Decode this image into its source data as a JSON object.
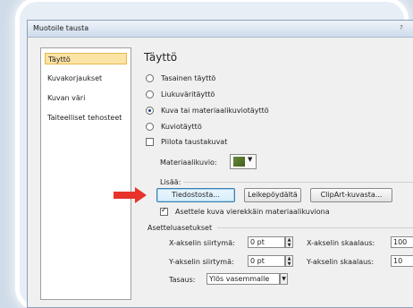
{
  "dialog": {
    "title": "Muotoile tausta",
    "help": "?"
  },
  "sidebar": {
    "items": [
      {
        "label": "Täyttö"
      },
      {
        "label": "Kuvakorjaukset"
      },
      {
        "label": "Kuvan väri"
      },
      {
        "label": "Taiteelliset tehosteet"
      }
    ]
  },
  "fill": {
    "heading": "Täyttö",
    "options": [
      {
        "label": "Tasainen täyttö",
        "checked": false
      },
      {
        "label": "Liukuväritäyttö",
        "checked": false
      },
      {
        "label": "Kuva tai materiaalikuviotäyttö",
        "checked": true
      },
      {
        "label": "Kuviotäyttö",
        "checked": false
      }
    ],
    "hide_background": "Piilota taustakuvat",
    "texture_label": "Materiaalikuvio:",
    "insert_from_label": "Lisää:",
    "buttons": {
      "file": "Tiedostosta...",
      "clipboard": "Leikepöydältä",
      "clipart": "ClipArt-kuvasta..."
    },
    "tile_label": "Asettele kuva vierekkäin materiaalikuviona",
    "tiling_heading": "Asetteluasetukset",
    "offset_x_label": "X-akselin siirtymä:",
    "offset_x_value": "0 pt",
    "offset_y_label": "Y-akselin siirtymä:",
    "offset_y_value": "0 pt",
    "scale_x_label": "X-akselin skaalaus:",
    "scale_x_value": "100",
    "scale_y_label": "Y-akselin skaalaus:",
    "scale_y_value": "10",
    "alignment_label": "Tasaus:",
    "alignment_value": "Ylös vasemmalle"
  },
  "colors": {
    "arrow": "#e8332a",
    "active_item": "#fbe3a6"
  }
}
